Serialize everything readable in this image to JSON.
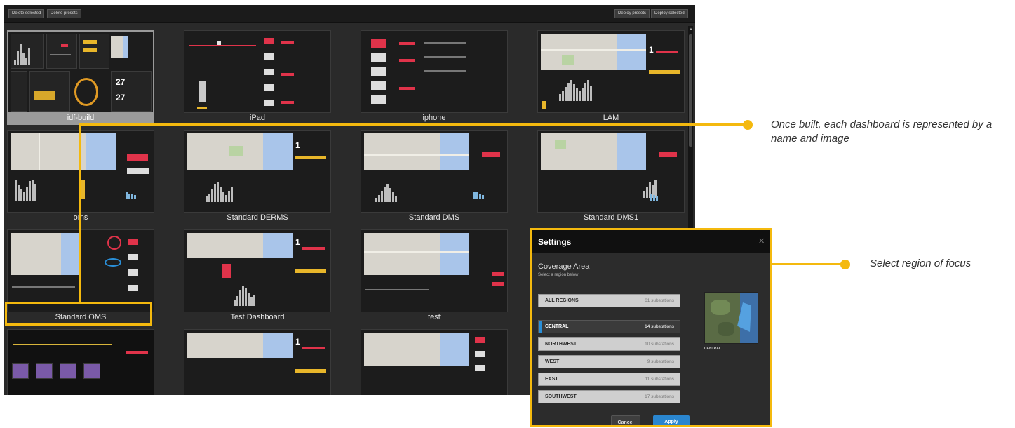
{
  "toolbar": {
    "delete_selected": "Delete selected",
    "delete_presets": "Delete presets",
    "deploy_presets": "Deploy presets",
    "deploy_selected": "Deploy selected"
  },
  "dashboards": [
    {
      "name": "idf-build",
      "selected": true
    },
    {
      "name": "iPad",
      "selected": false
    },
    {
      "name": "iphone",
      "selected": false
    },
    {
      "name": "LAM",
      "selected": false
    },
    {
      "name": "oms",
      "selected": false
    },
    {
      "name": "Standard DERMS",
      "selected": false
    },
    {
      "name": "Standard DMS",
      "selected": false
    },
    {
      "name": "Standard DMS1",
      "selected": false
    },
    {
      "name": "Standard OMS",
      "selected": false
    },
    {
      "name": "Test Dashboard",
      "selected": false
    },
    {
      "name": "test",
      "selected": false
    }
  ],
  "thumb_values": {
    "lam_number": "1",
    "derms_number": "1",
    "test_dashboard_number": "1",
    "row5_number": "1",
    "idf_value_a": "27",
    "idf_value_b": "27"
  },
  "callouts": {
    "dashboard": "Once built, each dashboard is represented by a name and image",
    "region": "Select region of focus"
  },
  "settings": {
    "title": "Settings",
    "close": "×",
    "coverage_title": "Coverage Area",
    "coverage_subtitle": "Select a region below",
    "regions": [
      {
        "name": "ALL REGIONS",
        "count": "61 substations",
        "active": false
      },
      {
        "name": "CENTRAL",
        "count": "14 substations",
        "active": true
      },
      {
        "name": "NORTHWEST",
        "count": "10 substations",
        "active": false
      },
      {
        "name": "WEST",
        "count": "9 substations",
        "active": false
      },
      {
        "name": "EAST",
        "count": "11 substations",
        "active": false
      },
      {
        "name": "SOUTHWEST",
        "count": "17 substations",
        "active": false
      }
    ],
    "map_label": "CENTRAL",
    "cancel": "Cancel",
    "apply": "Apply"
  },
  "colors": {
    "accent_yellow": "#f4b90e",
    "apply_blue": "#2a86cf",
    "active_region_marker": "#2a8fd8",
    "alert_red": "#e0334a"
  }
}
